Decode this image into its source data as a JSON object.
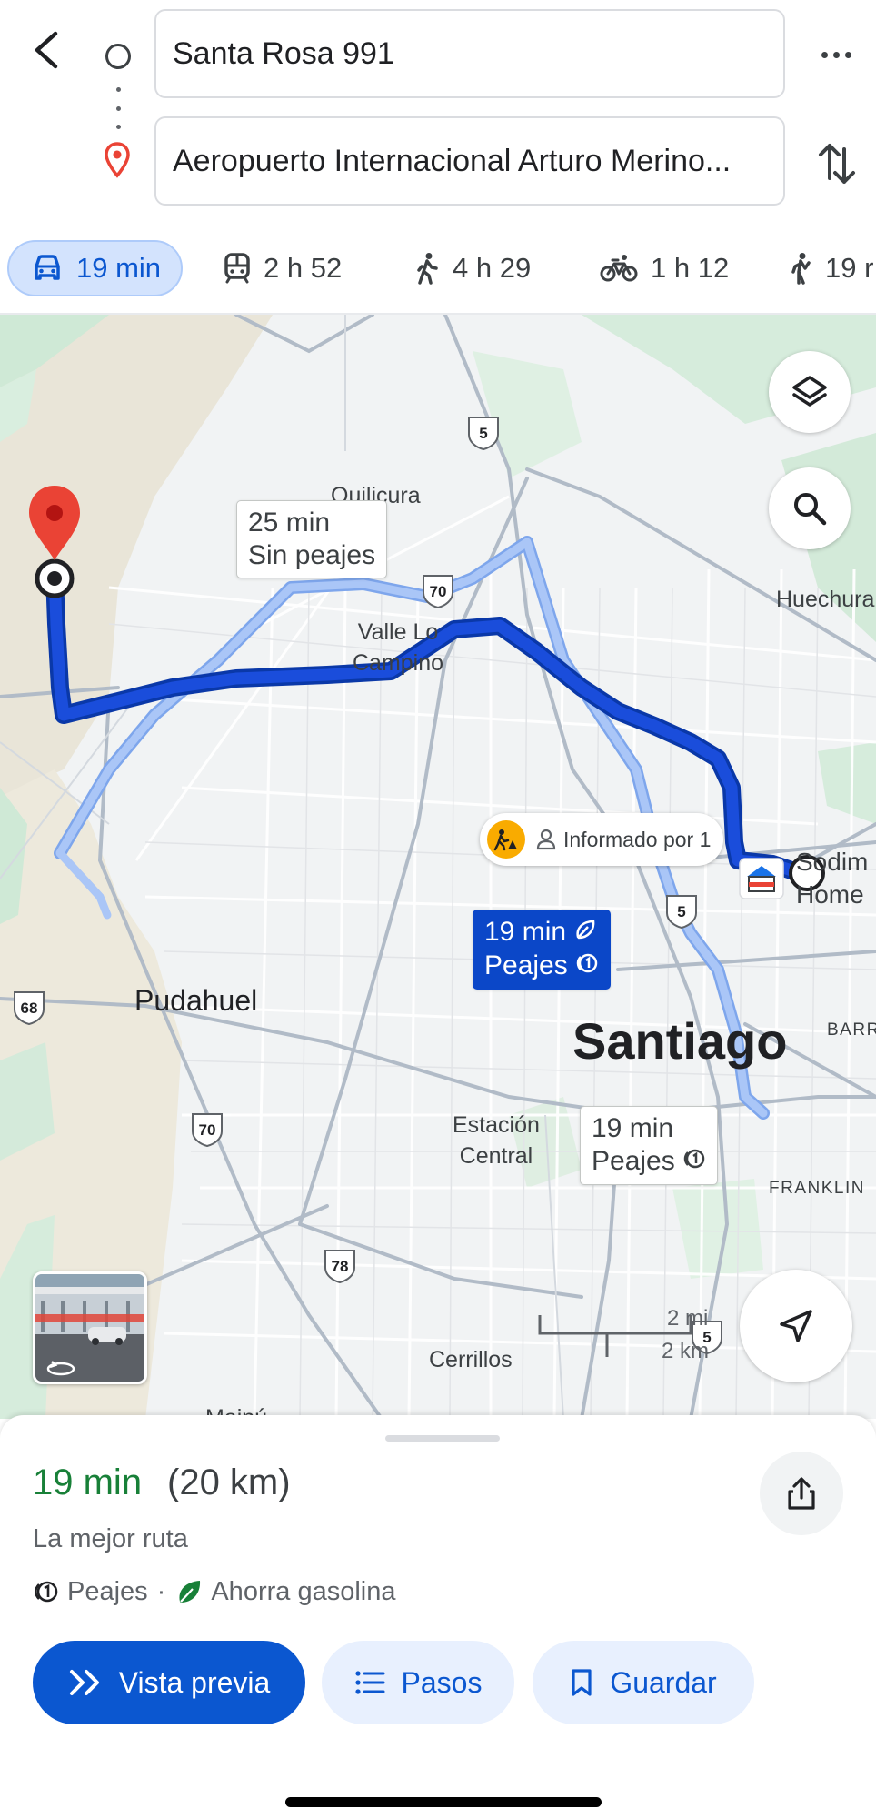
{
  "directions": {
    "origin": "Santa Rosa 991",
    "destination": "Aeropuerto Internacional Arturo Merino..."
  },
  "modes": [
    {
      "icon": "car-icon",
      "label": "19 min",
      "selected": true
    },
    {
      "icon": "transit-icon",
      "label": "2 h 52",
      "selected": false
    },
    {
      "icon": "walk-icon",
      "label": "4 h 29",
      "selected": false
    },
    {
      "icon": "bike-icon",
      "label": "1 h 12",
      "selected": false
    },
    {
      "icon": "ride-icon",
      "label": "19 r",
      "selected": false
    }
  ],
  "map": {
    "places": {
      "quilicura": "Quilicura",
      "valle": "Valle Lo\nCampino",
      "huechuraba": "Huechura",
      "pudahuel": "Pudahuel",
      "santiago": "Santiago",
      "estacion": "Estación\nCentral",
      "cerrillos": "Cerrillos",
      "maipu": "Maipú",
      "barrio": "BARR",
      "franklin": "FRANKLIN",
      "sodimac": "Sodim\nHome"
    },
    "shields": [
      "5",
      "70",
      "68",
      "70",
      "5",
      "78",
      "5"
    ],
    "callouts": {
      "alt_top": {
        "time": "25 min",
        "note": "Sin peajes"
      },
      "primary": {
        "time": "19 min",
        "note": "Peajes"
      },
      "alt_bottom": {
        "time": "19 min",
        "note": "Peajes"
      }
    },
    "incident": "Informado por 1",
    "scale": {
      "miles": "2 mi",
      "km": "2 km"
    }
  },
  "route": {
    "time": "19 min",
    "distance": "(20 km)",
    "subtitle": "La mejor ruta",
    "tolls": "Peajes",
    "separator": "·",
    "eco": "Ahorra gasolina"
  },
  "actions": {
    "preview": "Vista previa",
    "steps": "Pasos",
    "save": "Guardar"
  },
  "colors": {
    "route_primary": "#0b47c8",
    "route_alt": "#a8c7fa",
    "accent": "#0b57d0",
    "eco_green": "#188038",
    "pin_red": "#ea4335"
  }
}
